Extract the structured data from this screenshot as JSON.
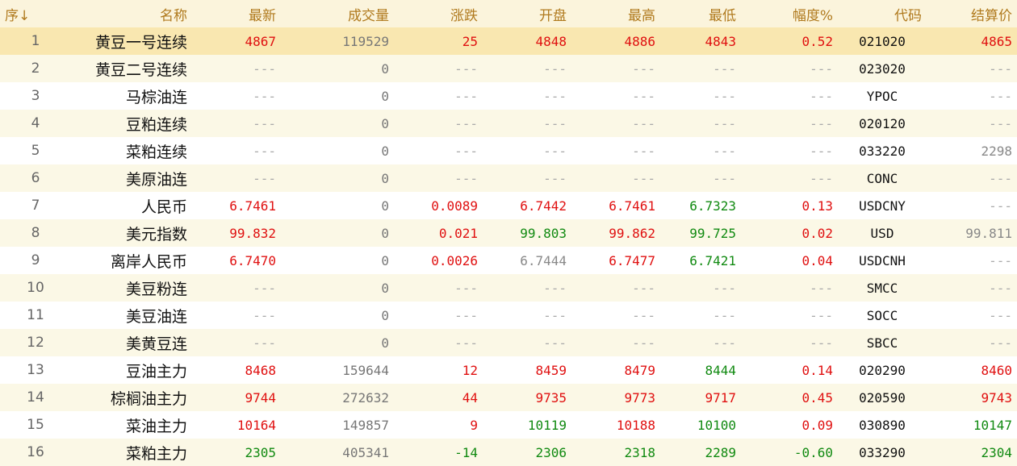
{
  "headers": [
    "序↓",
    "名称",
    "最新",
    "成交量",
    "涨跌",
    "开盘",
    "最高",
    "最低",
    "幅度%",
    "代码",
    "结算价"
  ],
  "selected_row": 0,
  "rows": [
    {
      "seq": "1",
      "name": "黄豆一号连续",
      "last": "4867",
      "vol": "119529",
      "chg": "25",
      "open": "4848",
      "high": "4886",
      "low": "4843",
      "pct": "0.52",
      "code": "021020",
      "settle": "4865",
      "col": {
        "last": "red",
        "chg": "red",
        "open": "red",
        "high": "red",
        "low": "red",
        "pct": "red",
        "settle": "red"
      }
    },
    {
      "seq": "2",
      "name": "黄豆二号连续",
      "last": "---",
      "vol": "0",
      "chg": "---",
      "open": "---",
      "high": "---",
      "low": "---",
      "pct": "---",
      "code": "023020",
      "settle": "---",
      "col": {}
    },
    {
      "seq": "3",
      "name": "马棕油连",
      "last": "---",
      "vol": "0",
      "chg": "---",
      "open": "---",
      "high": "---",
      "low": "---",
      "pct": "---",
      "code": "YPOC",
      "settle": "---",
      "col": {}
    },
    {
      "seq": "4",
      "name": "豆粕连续",
      "last": "---",
      "vol": "0",
      "chg": "---",
      "open": "---",
      "high": "---",
      "low": "---",
      "pct": "---",
      "code": "020120",
      "settle": "---",
      "col": {}
    },
    {
      "seq": "5",
      "name": "菜粕连续",
      "last": "---",
      "vol": "0",
      "chg": "---",
      "open": "---",
      "high": "---",
      "low": "---",
      "pct": "---",
      "code": "033220",
      "settle": "2298",
      "col": {
        "settle": "gray"
      }
    },
    {
      "seq": "6",
      "name": "美原油连",
      "last": "---",
      "vol": "0",
      "chg": "---",
      "open": "---",
      "high": "---",
      "low": "---",
      "pct": "---",
      "code": "CONC",
      "settle": "---",
      "col": {}
    },
    {
      "seq": "7",
      "name": "人民币",
      "last": "6.7461",
      "vol": "0",
      "chg": "0.0089",
      "open": "6.7442",
      "high": "6.7461",
      "low": "6.7323",
      "pct": "0.13",
      "code": "USDCNY",
      "settle": "---",
      "col": {
        "last": "red",
        "chg": "red",
        "open": "red",
        "high": "red",
        "low": "green",
        "pct": "red"
      }
    },
    {
      "seq": "8",
      "name": "美元指数",
      "last": "99.832",
      "vol": "0",
      "chg": "0.021",
      "open": "99.803",
      "high": "99.862",
      "low": "99.725",
      "pct": "0.02",
      "code": "USD",
      "settle": "99.811",
      "col": {
        "last": "red",
        "chg": "red",
        "open": "green",
        "high": "red",
        "low": "green",
        "pct": "red",
        "settle": "gray"
      }
    },
    {
      "seq": "9",
      "name": "离岸人民币",
      "last": "6.7470",
      "vol": "0",
      "chg": "0.0026",
      "open": "6.7444",
      "high": "6.7477",
      "low": "6.7421",
      "pct": "0.04",
      "code": "USDCNH",
      "settle": "---",
      "col": {
        "last": "red",
        "chg": "red",
        "open": "gray",
        "high": "red",
        "low": "green",
        "pct": "red"
      }
    },
    {
      "seq": "10",
      "name": "美豆粉连",
      "last": "---",
      "vol": "0",
      "chg": "---",
      "open": "---",
      "high": "---",
      "low": "---",
      "pct": "---",
      "code": "SMCC",
      "settle": "---",
      "col": {}
    },
    {
      "seq": "11",
      "name": "美豆油连",
      "last": "---",
      "vol": "0",
      "chg": "---",
      "open": "---",
      "high": "---",
      "low": "---",
      "pct": "---",
      "code": "SOCC",
      "settle": "---",
      "col": {}
    },
    {
      "seq": "12",
      "name": "美黄豆连",
      "last": "---",
      "vol": "0",
      "chg": "---",
      "open": "---",
      "high": "---",
      "low": "---",
      "pct": "---",
      "code": "SBCC",
      "settle": "---",
      "col": {}
    },
    {
      "seq": "13",
      "name": "豆油主力",
      "last": "8468",
      "vol": "159644",
      "chg": "12",
      "open": "8459",
      "high": "8479",
      "low": "8444",
      "pct": "0.14",
      "code": "020290",
      "settle": "8460",
      "col": {
        "last": "red",
        "chg": "red",
        "open": "red",
        "high": "red",
        "low": "green",
        "pct": "red",
        "settle": "red"
      }
    },
    {
      "seq": "14",
      "name": "棕榈油主力",
      "last": "9744",
      "vol": "272632",
      "chg": "44",
      "open": "9735",
      "high": "9773",
      "low": "9717",
      "pct": "0.45",
      "code": "020590",
      "settle": "9743",
      "col": {
        "last": "red",
        "chg": "red",
        "open": "red",
        "high": "red",
        "low": "red",
        "pct": "red",
        "settle": "red"
      }
    },
    {
      "seq": "15",
      "name": "菜油主力",
      "last": "10164",
      "vol": "149857",
      "chg": "9",
      "open": "10119",
      "high": "10188",
      "low": "10100",
      "pct": "0.09",
      "code": "030890",
      "settle": "10147",
      "col": {
        "last": "red",
        "chg": "red",
        "open": "green",
        "high": "red",
        "low": "green",
        "pct": "red",
        "settle": "green"
      }
    },
    {
      "seq": "16",
      "name": "菜粕主力",
      "last": "2305",
      "vol": "405341",
      "chg": "-14",
      "open": "2306",
      "high": "2318",
      "low": "2289",
      "pct": "-0.60",
      "code": "033290",
      "settle": "2304",
      "col": {
        "last": "green",
        "chg": "green",
        "open": "green",
        "high": "green",
        "low": "green",
        "pct": "green",
        "settle": "green"
      }
    }
  ]
}
